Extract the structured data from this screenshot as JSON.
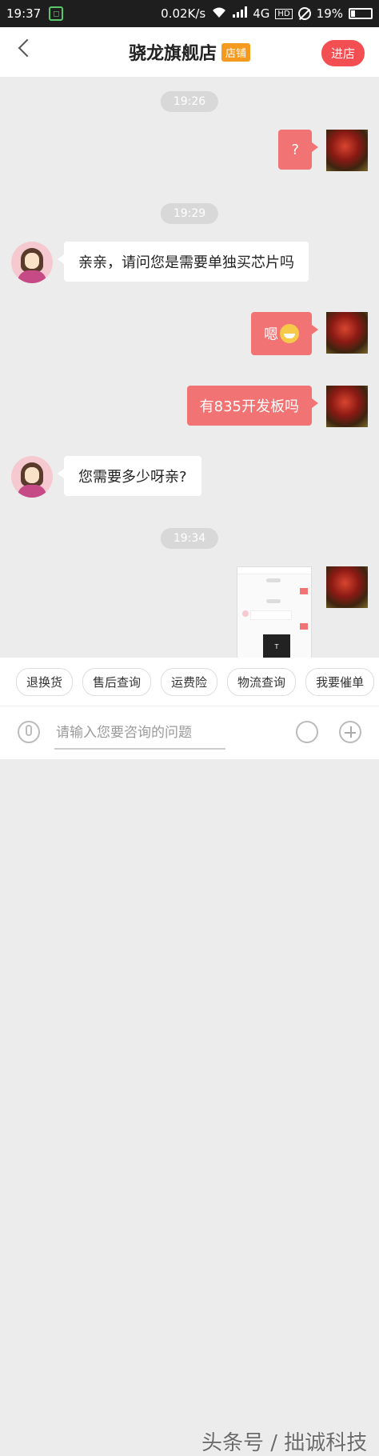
{
  "status_bar": {
    "time": "19:37",
    "speed": "0.02K/s",
    "network": "4G",
    "hd": "HD",
    "battery": "19%"
  },
  "header": {
    "title": "骁龙旗舰店",
    "shop_tag": "店铺",
    "enter_label": "进店"
  },
  "messages": {
    "ts1": "19:26",
    "m1": "?",
    "ts2": "19:29",
    "m2": "亲亲，请问您是需要单独买芯片吗",
    "m3": "嗯",
    "m4": "有835开发板吗",
    "m5": "您需要多少呀亲?",
    "ts3": "19:34"
  },
  "quick_replies": [
    "退换货",
    "售后查询",
    "运费险",
    "物流查询",
    "我要催单"
  ],
  "input": {
    "placeholder": "请输入您要咨询的问题"
  },
  "watermark": "头条号 / 拙诚科技",
  "colors": {
    "accent": "#f27373",
    "enter": "#f34f52",
    "tag": "#f39a1f"
  }
}
